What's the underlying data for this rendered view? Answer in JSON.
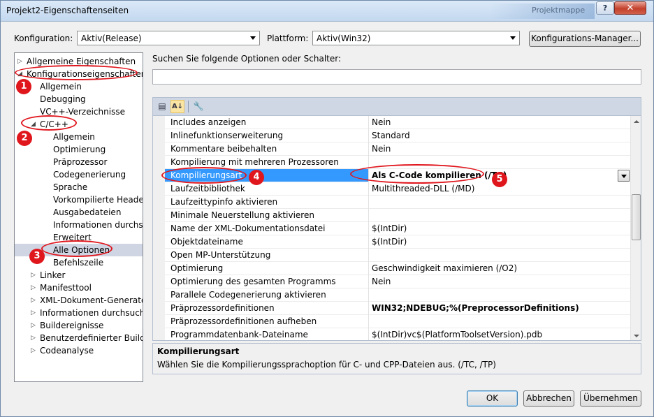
{
  "window": {
    "title": "Projekt2-Eigenschaftenseiten",
    "background_title": "Projektmappe",
    "help_label": "?",
    "close_label": "✕"
  },
  "config": {
    "label": "Konfiguration:",
    "value": "Aktiv(Release)",
    "platform_label": "Plattform:",
    "platform_value": "Aktiv(Win32)",
    "manager_button": "Konfigurations-Manager..."
  },
  "tree": {
    "items": [
      {
        "label": "Allgemeine Eigenschaften",
        "expander": "▷",
        "level": 0
      },
      {
        "label": "Konfigurationseigenschaften",
        "expander": "◢",
        "level": 0
      },
      {
        "label": "Allgemein",
        "expander": "",
        "level": 1
      },
      {
        "label": "Debugging",
        "expander": "",
        "level": 1
      },
      {
        "label": "VC++-Verzeichnisse",
        "expander": "",
        "level": 1
      },
      {
        "label": "C/C++",
        "expander": "◢",
        "level": 1
      },
      {
        "label": "Allgemein",
        "expander": "",
        "level": 2
      },
      {
        "label": "Optimierung",
        "expander": "",
        "level": 2
      },
      {
        "label": "Präprozessor",
        "expander": "",
        "level": 2
      },
      {
        "label": "Codegenerierung",
        "expander": "",
        "level": 2
      },
      {
        "label": "Sprache",
        "expander": "",
        "level": 2
      },
      {
        "label": "Vorkompilierte Header",
        "expander": "",
        "level": 2
      },
      {
        "label": "Ausgabedateien",
        "expander": "",
        "level": 2
      },
      {
        "label": "Informationen durchsuc",
        "expander": "",
        "level": 2
      },
      {
        "label": "Erweitert",
        "expander": "",
        "level": 2
      },
      {
        "label": "Alle Optionen",
        "expander": "",
        "level": 2,
        "selected": true
      },
      {
        "label": "Befehlszeile",
        "expander": "",
        "level": 2
      },
      {
        "label": "Linker",
        "expander": "▷",
        "level": 1
      },
      {
        "label": "Manifesttool",
        "expander": "▷",
        "level": 1
      },
      {
        "label": "XML-Dokument-Generator",
        "expander": "▷",
        "level": 1
      },
      {
        "label": "Informationen durchsuchen",
        "expander": "▷",
        "level": 1
      },
      {
        "label": "Buildereignisse",
        "expander": "▷",
        "level": 1
      },
      {
        "label": "Benutzerdefinierter Buildsch",
        "expander": "▷",
        "level": 1
      },
      {
        "label": "Codeanalyse",
        "expander": "▷",
        "level": 1
      }
    ]
  },
  "search": {
    "label": "Suchen Sie folgende Optionen oder Schalter:",
    "value": ""
  },
  "toolbar": {
    "categorized_icon": "▤",
    "alpha_icon": "A↓",
    "pages_icon": "🔧"
  },
  "properties": [
    {
      "name": "Includes anzeigen",
      "value": "Nein"
    },
    {
      "name": "Inlinefunktionserweiterung",
      "value": "Standard"
    },
    {
      "name": "Kommentare beibehalten",
      "value": "Nein"
    },
    {
      "name": "Kompilierung mit mehreren Prozessoren",
      "value": ""
    },
    {
      "name": "Kompilierungsart",
      "value": "Als C-Code kompilieren (/TC)",
      "selected": true,
      "bold": true
    },
    {
      "name": "Laufzeitbibliothek",
      "value": "Multithreaded-DLL (/MD)"
    },
    {
      "name": "Laufzeittypinfo aktivieren",
      "value": ""
    },
    {
      "name": "Minimale Neuerstellung aktivieren",
      "value": ""
    },
    {
      "name": "Name der XML-Dokumentationsdatei",
      "value": "$(IntDir)"
    },
    {
      "name": "Objektdateiname",
      "value": "$(IntDir)"
    },
    {
      "name": "Open MP-Unterstützung",
      "value": ""
    },
    {
      "name": "Optimierung",
      "value": "Geschwindigkeit maximieren (/O2)"
    },
    {
      "name": "Optimierung des gesamten Programms",
      "value": "Nein"
    },
    {
      "name": "Parallele Codegenerierung aktivieren",
      "value": ""
    },
    {
      "name": "Präprozessordefinitionen",
      "value": "WIN32;NDEBUG;%(PreprocessorDefinitions)",
      "bold": true
    },
    {
      "name": "Präprozessordefinitionen aufheben",
      "value": ""
    },
    {
      "name": "Programmdatenbank-Dateiname",
      "value": "$(IntDir)vc$(PlatformToolsetVersion).pdb"
    }
  ],
  "description": {
    "title": "Kompilierungsart",
    "text": "Wählen Sie die Kompilierungssprachoption für C- und CPP-Dateien aus.     (/TC, /TP)"
  },
  "buttons": {
    "ok": "OK",
    "cancel": "Abbrechen",
    "apply": "Übernehmen"
  },
  "annotations": {
    "markers": [
      "1",
      "2",
      "3",
      "4",
      "5"
    ],
    "color": "#e0161d"
  },
  "colors": {
    "selection": "#3399ff",
    "tree_selection": "#cfd5e2"
  }
}
